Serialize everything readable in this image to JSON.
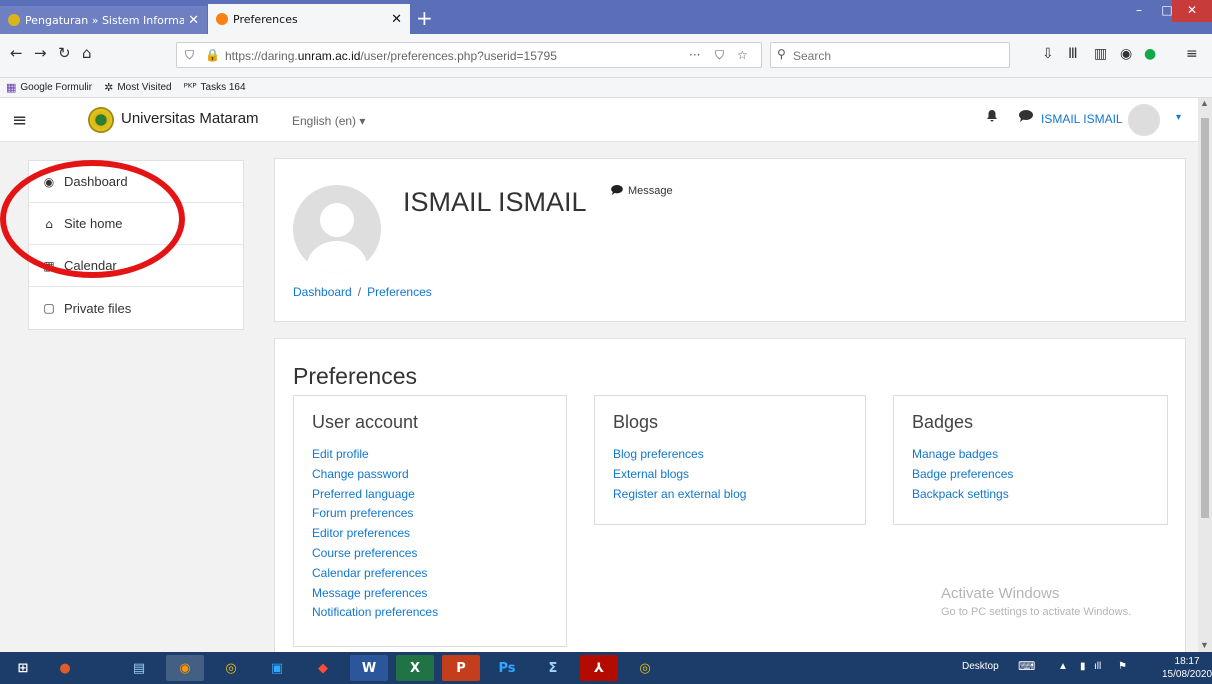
{
  "browser": {
    "tabs": [
      {
        "title": "Pengaturan » Sistem Informasi",
        "close": "✕",
        "active": false,
        "favicon_color": "#d9b51a"
      },
      {
        "title": "Preferences",
        "close": "✕",
        "active": true,
        "favicon_color": "#f98012"
      }
    ],
    "new_tab": "+",
    "window_controls": {
      "minimize": "–",
      "maximize": "□",
      "close": "✕"
    },
    "nav": {
      "back": "←",
      "forward": "→",
      "reload": "↻",
      "home": "⌂"
    },
    "url": {
      "prefix": "https://daring.",
      "domain": "unram.ac.id",
      "path": "/user/preferences.php?userid=15795"
    },
    "url_actions": "···",
    "search_placeholder": "Search",
    "bookmarks": [
      {
        "icon": "▦",
        "label": "Google Formulir"
      },
      {
        "icon": "✲",
        "label": "Most Visited"
      },
      {
        "icon": "ᴾᴷᴾ",
        "label": "Tasks 164"
      }
    ]
  },
  "header": {
    "menu_icon": "≡",
    "site_name": "Universitas Mataram",
    "language": "English (en) ▾",
    "bell": "🔔",
    "chat": "💬",
    "username": "ISMAIL ISMAIL",
    "caret": "▾"
  },
  "sidebar": {
    "items": [
      {
        "icon": "◉",
        "label": "Dashboard"
      },
      {
        "icon": "⌂",
        "label": "Site home"
      },
      {
        "icon": "▦",
        "label": "Calendar"
      },
      {
        "icon": "▢",
        "label": "Private files"
      }
    ]
  },
  "profile": {
    "full_name": "ISMAIL ISMAIL",
    "message_icon": "💬",
    "message_label": "Message",
    "breadcrumb": [
      "Dashboard",
      "Preferences"
    ],
    "breadcrumb_sep": "/"
  },
  "preferences": {
    "title": "Preferences",
    "user_account": {
      "heading": "User account",
      "links": [
        "Edit profile",
        "Change password",
        "Preferred language",
        "Forum preferences",
        "Editor preferences",
        "Course preferences",
        "Calendar preferences",
        "Message preferences",
        "Notification preferences"
      ]
    },
    "blogs": {
      "heading": "Blogs",
      "links": [
        "Blog preferences",
        "External blogs",
        "Register an external blog"
      ]
    },
    "badges": {
      "heading": "Badges",
      "links": [
        "Manage badges",
        "Badge preferences",
        "Backpack settings"
      ]
    }
  },
  "watermark": {
    "line1": "Activate Windows",
    "line2": "Go to PC settings to activate Windows."
  },
  "taskbar": {
    "apps": [
      "⊞",
      "●",
      "▤",
      "◉",
      "◎",
      "▣",
      "◆",
      "W",
      "X",
      "P",
      "Ps",
      "Σ",
      "⅄",
      "◎"
    ],
    "desktop_label": "Desktop",
    "time": "18:17",
    "date": "15/08/2020"
  },
  "colors": {
    "link": "#1177d1",
    "tabbar": "#5a6fb8",
    "taskbar": "#1c3c69",
    "annotation_circle": "#e51414"
  }
}
